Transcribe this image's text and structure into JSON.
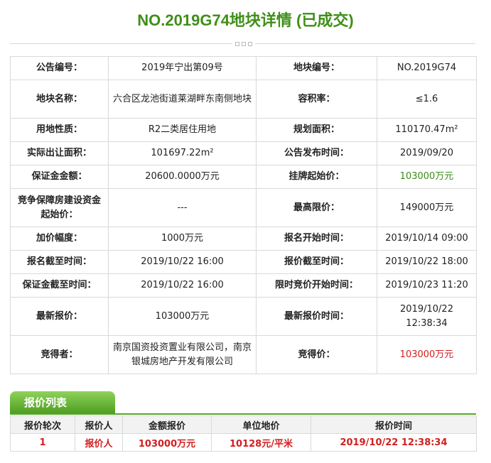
{
  "title": "NO.2019G74地块详情 (已成交)",
  "rows": [
    {
      "l1": "公告编号：",
      "v1": "2019年宁出第09号",
      "l2": "地块编号：",
      "v2": "NO.2019G74"
    },
    {
      "l1": "地块名称：",
      "v1": "六合区龙池街道莱湖畔东南侧地块",
      "l2": "容积率：",
      "v2": "≤1.6"
    },
    {
      "l1": "用地性质：",
      "v1": "R2二类居住用地",
      "l2": "规划面积：",
      "v2": "110170.47m²"
    },
    {
      "l1": "实际出让面积：",
      "v1": "101697.22m²",
      "l2": "公告发布时间：",
      "v2": "2019/09/20"
    },
    {
      "l1": "保证金金额：",
      "v1": "20600.0000万元",
      "l2": "挂牌起始价：",
      "v2": "103000万元"
    },
    {
      "l1": "竞争保障房建设资金起始价：",
      "v1": "---",
      "l2": "最高限价：",
      "v2": "149000万元"
    },
    {
      "l1": "加价幅度：",
      "v1": "1000万元",
      "l2": "报名开始时间：",
      "v2": "2019/10/14 09:00"
    },
    {
      "l1": "报名截至时间：",
      "v1": "2019/10/22 16:00",
      "l2": "报价截至时间：",
      "v2": "2019/10/22 18:00"
    },
    {
      "l1": "保证金截至时间：",
      "v1": "2019/10/22 16:00",
      "l2": "限时竞价开始时间：",
      "v2": "2019/10/23 11:20"
    },
    {
      "l1": "最新报价：",
      "v1": "103000万元",
      "l2": "最新报价时间：",
      "v2": "2019/10/22 12:38:34"
    },
    {
      "l1": "竞得者：",
      "v1": "南京国资投资置业有限公司，南京银城房地产开发有限公司",
      "l2": "竞得价：",
      "v2": "103000万元"
    }
  ],
  "bid_tab": "报价列表",
  "bid_headers": [
    "报价轮次",
    "报价人",
    "金额报价",
    "单位地价",
    "报价时间"
  ],
  "bid_rows": [
    [
      "1",
      "报价人",
      "103000万元",
      "10128元/平米",
      "2019/10/22 12:38:34"
    ]
  ],
  "colors": {
    "green": "#3f8f18",
    "red": "#d21e1e"
  }
}
